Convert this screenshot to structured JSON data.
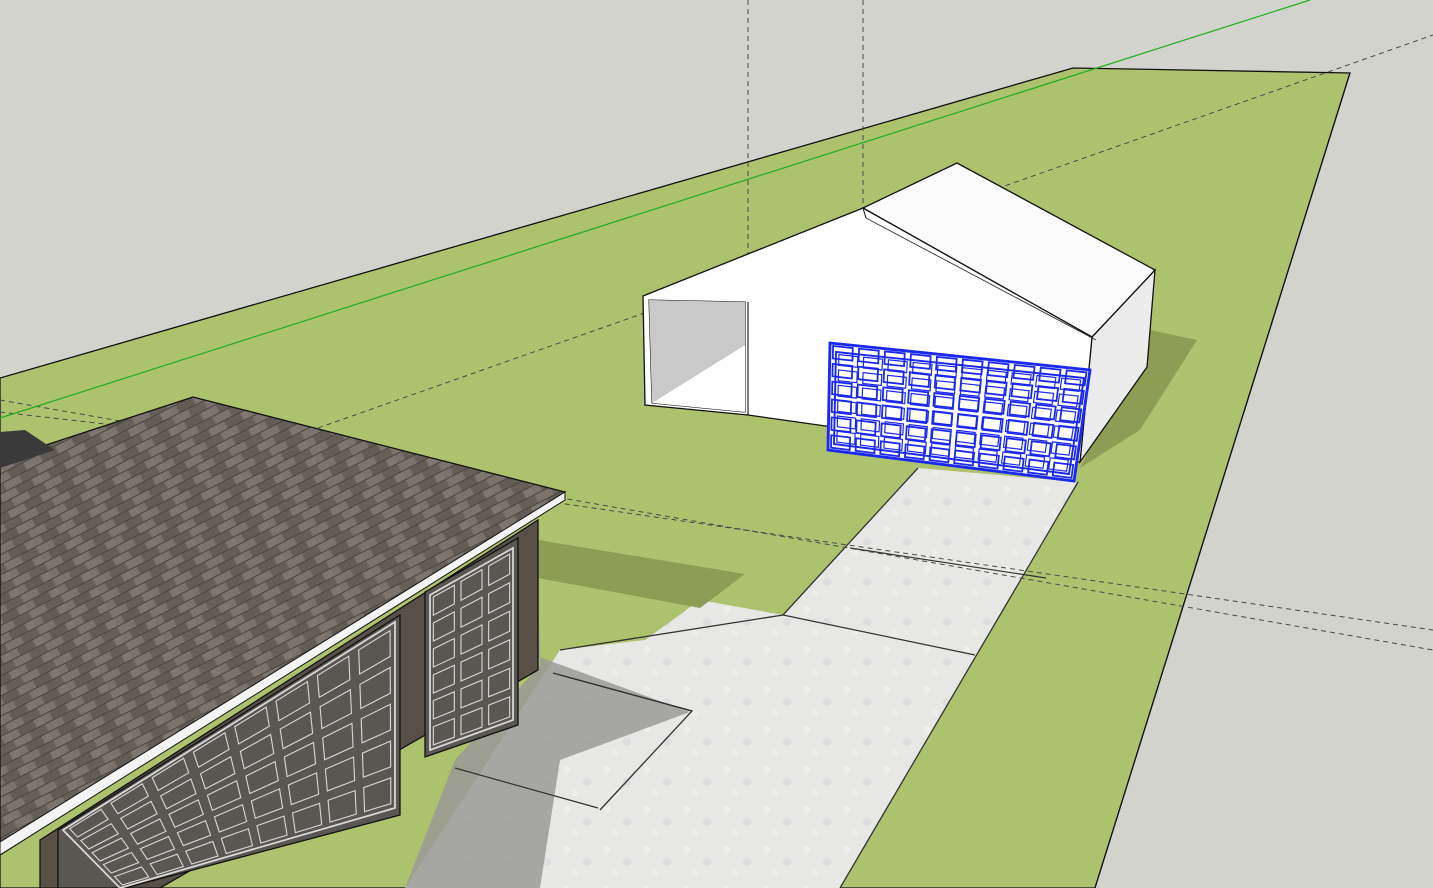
{
  "app": {
    "type": "3d-modeling-viewport"
  },
  "colors": {
    "sky": "#d2d3cd",
    "grass": "#adc26d",
    "grass_shadow": "#8d9e54",
    "concrete": "#e6e6e4",
    "concrete_shadow": "#9a9a98",
    "wall_white": "#ffffff",
    "wall_shade": "#ececec",
    "wall_dark": "#b4b4b4",
    "roof_shingle": "#6e6861",
    "house_brick": "#585047",
    "garage_door_house": "#5a5753",
    "selection_blue": "#1b28ee",
    "green_axis": "#1fae1f",
    "guide_line": "#4a4a4a"
  },
  "scene": {
    "objects": [
      {
        "name": "ground-plane",
        "kind": "face"
      },
      {
        "name": "detached-garage",
        "kind": "group"
      },
      {
        "name": "selected-garage-door",
        "kind": "component",
        "selected": true
      },
      {
        "name": "driveway",
        "kind": "face"
      },
      {
        "name": "house",
        "kind": "group"
      }
    ],
    "axes": [
      {
        "name": "green-axis",
        "color": "#1fae1f"
      }
    ]
  }
}
